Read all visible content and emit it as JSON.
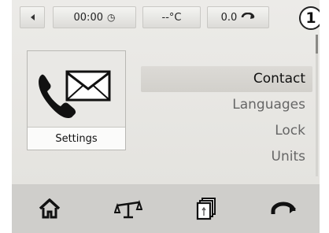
{
  "status_bar": {
    "time": "00:00",
    "temperature": "--°C",
    "consumption": "0.0"
  },
  "step_badge": "1",
  "tile": {
    "label": "Settings"
  },
  "menu": {
    "items": [
      {
        "label": "Contact",
        "selected": true
      },
      {
        "label": "Languages",
        "selected": false
      },
      {
        "label": "Lock",
        "selected": false
      },
      {
        "label": "Units",
        "selected": false
      }
    ]
  },
  "bottom_bar": {
    "icons": [
      "home-icon",
      "scale-icon",
      "cards-icon",
      "rotate-icon"
    ]
  }
}
